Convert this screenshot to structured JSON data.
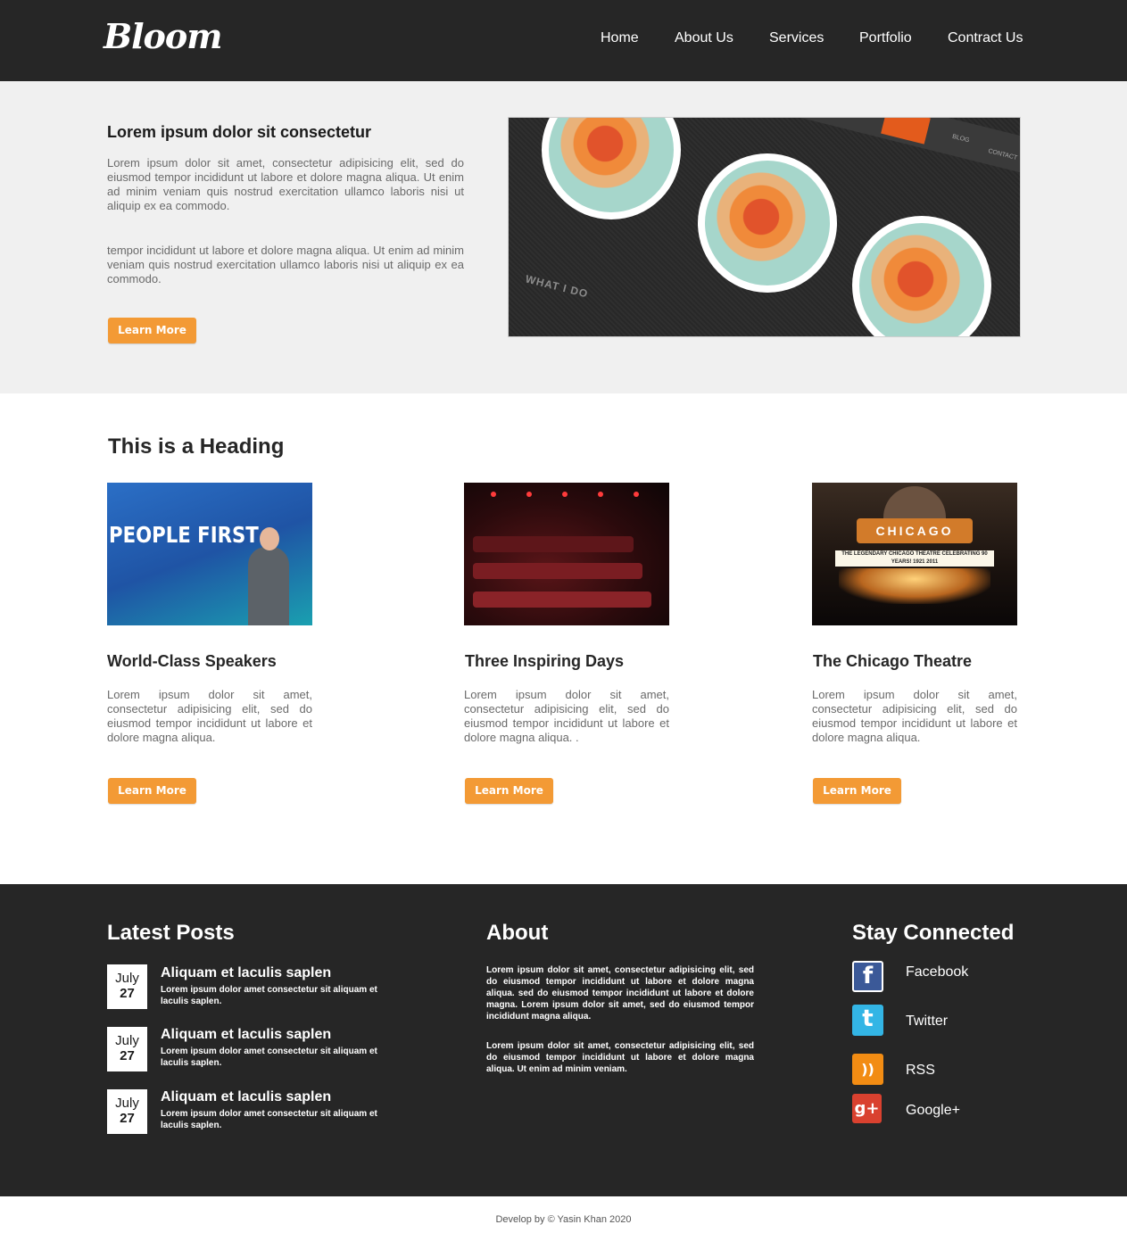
{
  "header": {
    "logo": "Bloom",
    "nav": [
      "Home",
      "About Us",
      "Services",
      "Portfolio",
      "Contract Us"
    ]
  },
  "hero": {
    "title": "Lorem ipsum dolor sit consectetur",
    "paragraph1": "Lorem ipsum dolor sit amet, consectetur adipisicing elit, sed do eiusmod tempor incididunt ut labore et dolore magna aliqua. Ut enim ad minim veniam quis nostrud exercitation ullamco laboris nisi ut aliquip ex ea commodo.",
    "paragraph2": "tempor incididunt ut labore et dolore magna aliqua. Ut enim ad minim veniam quis nostrud exercitation ullamco laboris nisi ut aliquip ex ea commodo.",
    "button": "Learn More",
    "image_text": "WHAT I DO",
    "image_menu": [
      "BLOG",
      "CONTACT"
    ]
  },
  "section": {
    "heading": "This is a Heading",
    "cards": [
      {
        "title": "World-Class Speakers",
        "text": "Lorem ipsum dolor sit amet, consectetur adipisicing elit, sed do eiusmod tempor incididunt ut labore et dolore magna aliqua.",
        "button": "Learn More",
        "image_text": "PEOPLE FIRST"
      },
      {
        "title": "Three Inspiring Days",
        "text": "Lorem ipsum dolor sit amet, consectetur adipisicing elit, sed do eiusmod tempor incididunt ut labore et dolore magna aliqua. .",
        "button": "Learn More"
      },
      {
        "title": "The Chicago Theatre",
        "text": "Lorem ipsum dolor sit amet, consectetur adipisicing elit, sed do eiusmod tempor incididunt ut labore et dolore magna aliqua.",
        "button": "Learn More",
        "image_text": "CHICAGO",
        "marquee": "THE LEGENDARY CHICAGO THEATRE CELEBRATING 90 YEARS! 1921 2011"
      }
    ]
  },
  "footer": {
    "latest_posts": {
      "heading": "Latest Posts",
      "posts": [
        {
          "month": "July",
          "day": "27",
          "title": "Aliquam et laculis saplen",
          "text": "Lorem ipsum dolor amet consectetur sit aliquam et laculis saplen."
        },
        {
          "month": "July",
          "day": "27",
          "title": "Aliquam et laculis saplen",
          "text": "Lorem ipsum dolor amet consectetur sit aliquam et laculis saplen."
        },
        {
          "month": "July",
          "day": "27",
          "title": "Aliquam et laculis saplen",
          "text": "Lorem ipsum dolor amet consectetur sit aliquam et laculis saplen."
        }
      ]
    },
    "about": {
      "heading": "About",
      "paragraph1": "Lorem ipsum dolor sit amet, consectetur adipisicing elit, sed do eiusmod tempor incididunt ut labore et dolore magna aliqua. sed do eiusmod tempor incididunt ut labore et dolore magna. Lorem ipsum dolor sit amet, sed do eiusmod tempor incididunt magna aliqua.",
      "paragraph2": "Lorem ipsum dolor sit amet, consectetur adipisicing elit, sed do eiusmod tempor incididunt ut labore et dolore magna aliqua. Ut enim ad minim veniam."
    },
    "stay_connected": {
      "heading": "Stay Connected",
      "links": [
        {
          "label": "Facebook",
          "icon": "facebook-icon",
          "glyph": "f",
          "color": "#3b5998"
        },
        {
          "label": "Twitter",
          "icon": "twitter-icon",
          "glyph": "t",
          "color": "#33b5e5"
        },
        {
          "label": "RSS",
          "icon": "rss-icon",
          "glyph": "))",
          "color": "#f28c13"
        },
        {
          "label": "Google+",
          "icon": "google-plus-icon",
          "glyph": "g+",
          "color": "#d9412f"
        }
      ]
    }
  },
  "copyright": "Develop by © Yasin Khan 2020",
  "colors": {
    "header_bg": "#262626",
    "hero_bg": "#f0f0f0",
    "accent": "#f39a35",
    "footer_bg": "#262626"
  }
}
